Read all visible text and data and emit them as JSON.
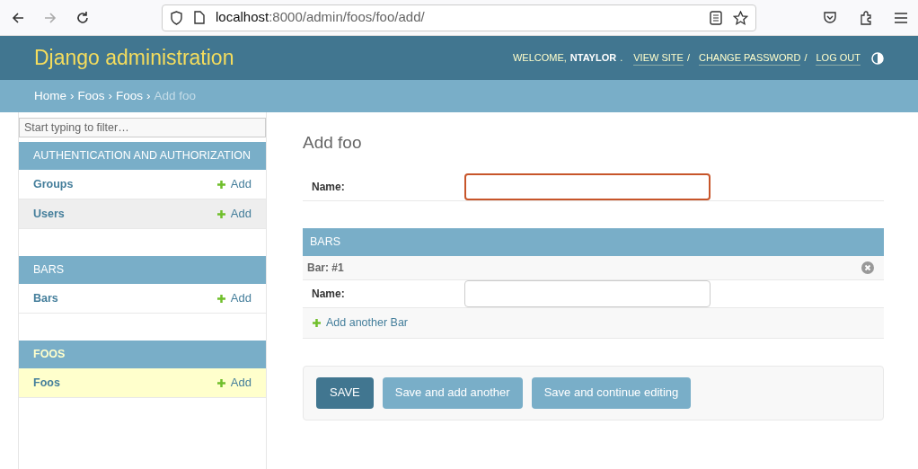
{
  "browser": {
    "url_host": "localhost",
    "url_path": ":8000/admin/foos/foo/add/"
  },
  "header": {
    "title": "Django administration",
    "welcome": "WELCOME,",
    "user": "NTAYLOR",
    "user_suffix": ".",
    "separator": "/",
    "links": [
      {
        "label": "VIEW SITE"
      },
      {
        "label": "CHANGE PASSWORD"
      },
      {
        "label": "LOG OUT"
      }
    ]
  },
  "breadcrumb_separator": "›",
  "breadcrumbs": [
    {
      "label": "Home",
      "current": false
    },
    {
      "label": "Foos",
      "current": false
    },
    {
      "label": "Foos",
      "current": false
    },
    {
      "label": "Add foo",
      "current": true
    }
  ],
  "sidebar": {
    "filter_placeholder": "Start typing to filter…",
    "apps": [
      {
        "name": "AUTHENTICATION AND AUTHORIZATION",
        "selected": false,
        "models": [
          {
            "name": "Groups",
            "add": "Add",
            "selected": false,
            "hovered": false
          },
          {
            "name": "Users",
            "add": "Add",
            "selected": false,
            "hovered": true
          }
        ]
      },
      {
        "name": "BARS",
        "selected": false,
        "models": [
          {
            "name": "Bars",
            "add": "Add",
            "selected": false,
            "hovered": false
          }
        ]
      },
      {
        "name": "FOOS",
        "selected": true,
        "models": [
          {
            "name": "Foos",
            "add": "Add",
            "selected": true,
            "hovered": false
          }
        ]
      }
    ]
  },
  "content": {
    "title": "Add foo",
    "fields": [
      {
        "label": "Name:",
        "focused": true
      }
    ],
    "inline": {
      "title": "BARS",
      "items": [
        {
          "title": "Bar: #1",
          "fields": [
            {
              "label": "Name:",
              "focused": false
            }
          ]
        }
      ],
      "add_another": "Add another Bar"
    },
    "buttons": [
      {
        "label": "SAVE",
        "kind": "default"
      },
      {
        "label": "Save and add another",
        "kind": "secondary"
      },
      {
        "label": "Save and continue editing",
        "kind": "secondary"
      }
    ]
  }
}
